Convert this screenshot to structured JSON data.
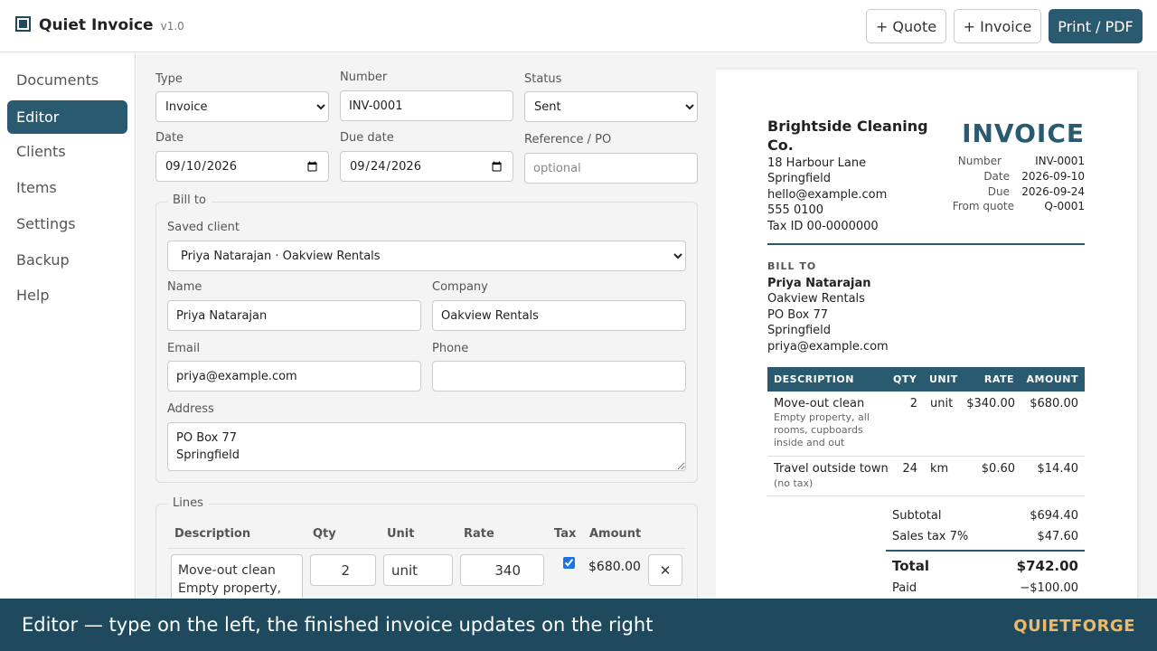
{
  "app": {
    "name": "Quiet Invoice",
    "version": "v1.0",
    "icon": "invoice-app-icon"
  },
  "header": {
    "quote_button": "+ Quote",
    "invoice_button": "+ Invoice",
    "print_button": "Print / PDF"
  },
  "sidebar": {
    "items": [
      {
        "label": "Documents",
        "active": false
      },
      {
        "label": "Editor",
        "active": true
      },
      {
        "label": "Clients",
        "active": false
      },
      {
        "label": "Items",
        "active": false
      },
      {
        "label": "Settings",
        "active": false
      },
      {
        "label": "Backup",
        "active": false
      },
      {
        "label": "Help",
        "active": false
      }
    ]
  },
  "editor": {
    "type": {
      "label": "Type",
      "value": "Invoice",
      "options": [
        "Invoice"
      ]
    },
    "number": {
      "label": "Number",
      "value": "INV-0001"
    },
    "status": {
      "label": "Status",
      "value": "Sent",
      "options": [
        "Sent"
      ]
    },
    "date": {
      "label": "Date",
      "value": "2026-09-10"
    },
    "due_date": {
      "label": "Due date",
      "value": "2026-09-24"
    },
    "reference": {
      "label": "Reference / PO",
      "value": "",
      "placeholder": "optional"
    },
    "bill_to": {
      "legend": "Bill to",
      "saved_client": {
        "label": "Saved client",
        "value": "Priya Natarajan · Oakview Rentals",
        "options": [
          "Priya Natarajan · Oakview Rentals"
        ]
      },
      "name": {
        "label": "Name",
        "value": "Priya Natarajan"
      },
      "company": {
        "label": "Company",
        "value": "Oakview Rentals"
      },
      "email": {
        "label": "Email",
        "value": "priya@example.com"
      },
      "phone": {
        "label": "Phone",
        "value": ""
      },
      "address": {
        "label": "Address",
        "value": "PO Box 77\nSpringfield"
      }
    },
    "lines": {
      "legend": "Lines",
      "columns": [
        "Description",
        "Qty",
        "Unit",
        "Rate",
        "Tax",
        "Amount"
      ],
      "rows": [
        {
          "description": "Move-out clean\nEmpty property,",
          "qty": "2",
          "unit": "unit",
          "rate": "340",
          "tax": true,
          "amount": "$680.00",
          "remove": "✕"
        }
      ]
    }
  },
  "preview": {
    "business": {
      "name": "Brightside Cleaning Co.",
      "address1": "18 Harbour Lane",
      "city": "Springfield",
      "email": "hello@example.com",
      "phone": "555 0100",
      "tax_id": "Tax ID 00-0000000"
    },
    "doc_title": "INVOICE",
    "meta": [
      {
        "label": "Number",
        "value": "INV-0001"
      },
      {
        "label": "Date",
        "value": "2026-09-10"
      },
      {
        "label": "Due",
        "value": "2026-09-24"
      },
      {
        "label": "From quote",
        "value": "Q-0001"
      }
    ],
    "bill_to": {
      "heading": "BILL TO",
      "name": "Priya Natarajan",
      "company": "Oakview Rentals",
      "address1": "PO Box 77",
      "city": "Springfield",
      "email": "priya@example.com"
    },
    "table": {
      "headers": [
        "DESCRIPTION",
        "QTY",
        "UNIT",
        "RATE",
        "AMOUNT"
      ],
      "rows": [
        {
          "description": "Move-out clean",
          "note": "Empty property, all rooms, cupboards inside and out",
          "qty": "2",
          "unit": "unit",
          "rate": "$340.00",
          "amount": "$680.00"
        },
        {
          "description": "Travel outside town",
          "note": "(no tax)",
          "qty": "24",
          "unit": "km",
          "rate": "$0.60",
          "amount": "$14.40"
        }
      ]
    },
    "totals": {
      "subtotal_label": "Subtotal",
      "subtotal": "$694.40",
      "tax_label": "Sales tax 7%",
      "tax": "$47.60",
      "total_label": "Total",
      "total": "$742.00",
      "paid_label": "Paid",
      "paid": "−$100.00"
    }
  },
  "caption": {
    "text": "Editor — type on the left, the finished invoice updates on the right",
    "brand": "QUIETFORGE"
  },
  "colors": {
    "primary": "#2a5a70",
    "caption_bg": "#1f4a5e",
    "caption_brand": "#f0b96a"
  }
}
